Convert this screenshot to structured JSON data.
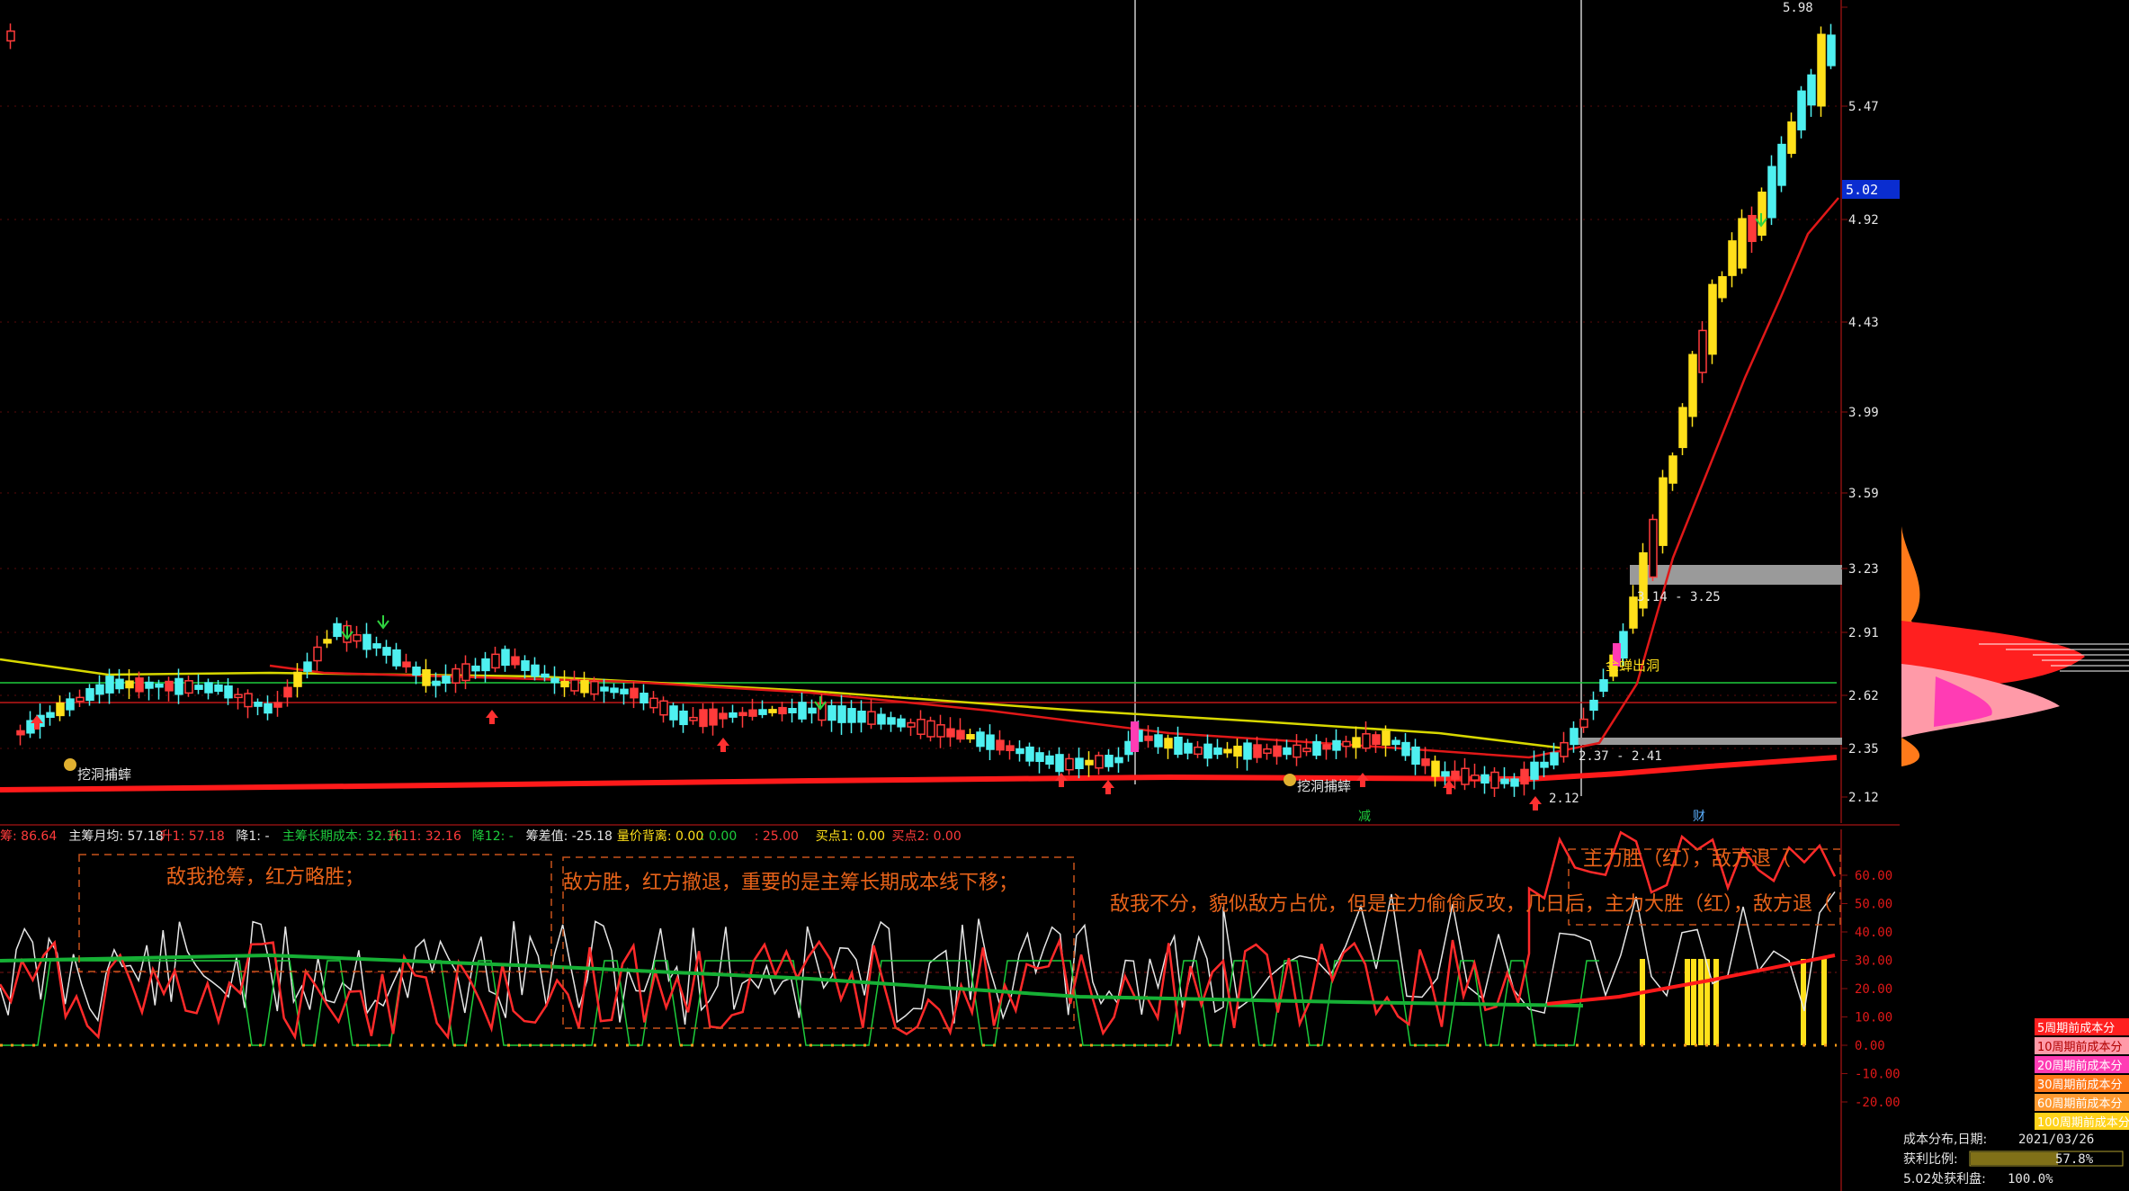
{
  "colors": {
    "up": "#ff3b3b",
    "down": "#4ef0f0",
    "hi": "#ffe01a",
    "mag": "#ff3cb4",
    "ma_red": "#ff1a1a",
    "ma_yellow": "#d8d800",
    "green": "#1dcc3c",
    "white": "#e6e6e6",
    "cost_orange": "#ff7a1a"
  },
  "main": {
    "y_ticks": [
      "5.98",
      "5.47",
      "4.92",
      "4.43",
      "3.99",
      "3.59",
      "3.23",
      "2.91",
      "2.62",
      "2.35",
      "2.12"
    ],
    "price_tag": "5.02",
    "annotations": {
      "zone_label": "3.14 - 3.25",
      "low_label": "2.12",
      "mid_label": "2.37 - 2.41",
      "signal_left": "挖洞捕蟀",
      "signal_mid": "挖洞捕蟀",
      "signal_right": "金蝉出洞",
      "marker_a": "减",
      "marker_b": "财"
    }
  },
  "indicator": {
    "header": [
      {
        "text": "筹: 86.64",
        "color": "#ff3b3b"
      },
      {
        "text": "主筹月均: 57.18",
        "color": "#e6e6e6"
      },
      {
        "text": "升1: 57.18",
        "color": "#ff3b3b"
      },
      {
        "text": "降1: -",
        "color": "#e6e6e6"
      },
      {
        "text": "主筹长期成本: 32.16",
        "color": "#1dcc3c"
      },
      {
        "text": "升11: 32.16",
        "color": "#ff3b3b"
      },
      {
        "text": "降12: -",
        "color": "#1dcc3c"
      },
      {
        "text": "筹差值: -25.18",
        "color": "#e6e6e6"
      },
      {
        "text": "量价背离: 0.00",
        "color": "#ffe01a"
      },
      {
        "text": ": 0.00",
        "color": "#1dcc3c"
      },
      {
        "text": ": 25.00",
        "color": "#ff3b3b"
      },
      {
        "text": "买点1: 0.00",
        "color": "#ffe01a"
      },
      {
        "text": "买点2: 0.00",
        "color": "#ff3b3b"
      }
    ],
    "y_ticks": [
      "60.00",
      "50.00",
      "40.00",
      "30.00",
      "20.00",
      "10.00",
      "0.00",
      "-10.00",
      "-20.00"
    ],
    "notes": [
      "敌我抢筹，红方略胜；",
      "敌方胜，红方撤退，重要的是主筹长期成本线下移；",
      "敌我不分，貌似敌方占优，但是主力偷偷反攻，几日后，主力大胜（红），敌方退（",
      "主力胜（红），敌方退（"
    ]
  },
  "cost_panel": {
    "legend": [
      "5周期前成本分",
      "10周期前成本分",
      "20周期前成本分",
      "30周期前成本分",
      "60周期前成本分",
      "100周期前成本分"
    ],
    "legend_colors": [
      "#ff1f1f",
      "#ff9aa8",
      "#ff3cb4",
      "#ff7a1a",
      "#ff9a30",
      "#ffd21a"
    ],
    "date_label": "成本分布,日期:",
    "date": "2021/03/26",
    "profit_label": "获利比例:",
    "profit": "57.8%",
    "profit_value": 0.578,
    "at_price_label": "5.02处获利盘:",
    "at_price": "100.0%"
  }
}
